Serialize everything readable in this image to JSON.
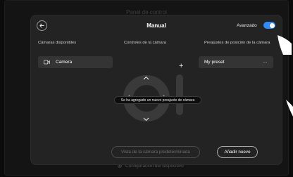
{
  "background": {
    "title": "Panel de control",
    "footer_label": "Configuración del dispositivo",
    "footer_icon": "gear-icon"
  },
  "panel": {
    "back_icon": "arrow-left-icon",
    "title": "Manual",
    "advanced": {
      "label": "Avanzado",
      "enabled": true,
      "color": "#2f8bf7"
    }
  },
  "cameras": {
    "heading": "Cámaras disponibles",
    "items": [
      {
        "icon": "video-camera-icon",
        "label": "Camera"
      }
    ]
  },
  "controls": {
    "heading": "Controles de la cámara",
    "icons": [
      "chevron-up-icon",
      "chevron-left-icon",
      "chevron-right-icon",
      "chevron-down-icon",
      "plus-icon"
    ]
  },
  "presets": {
    "heading": "Preajustes de posición de la cámara",
    "items": [
      {
        "label": "My preset",
        "menu_icon": "more-icon"
      }
    ]
  },
  "toast": "Se ha agregado un nuevo preajuste de cámara",
  "buttons": {
    "default_view": "Vista de la cámara predeterminada",
    "add_new": "Añadir nuevo"
  }
}
